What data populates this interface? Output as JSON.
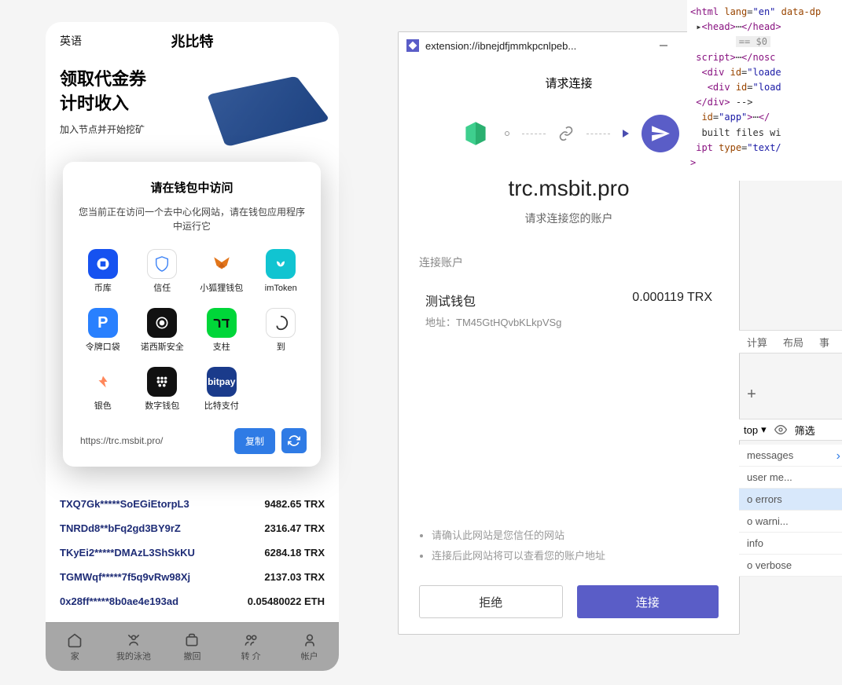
{
  "mobile": {
    "lang": "英语",
    "title": "兆比特",
    "hero_line1": "领取代金券",
    "hero_line2": "计时收入",
    "hero_sub": "加入节点并开始挖矿",
    "transactions": [
      {
        "addr": "TXQ7Gk*****SoEGiEtorpL3",
        "amt": "9482.65 TRX"
      },
      {
        "addr": "TNRDd8**bFq2gd3BY9rZ",
        "amt": "2316.47 TRX"
      },
      {
        "addr": "TKyEi2*****DMAzL3ShSkKU",
        "amt": "6284.18 TRX"
      },
      {
        "addr": "TGMWqf*****7f5q9vRw98Xj",
        "amt": "2137.03 TRX"
      },
      {
        "addr": "0x28ff*****8b0ae4e193ad",
        "amt": "0.05480022 ETH"
      }
    ],
    "nav": [
      "家",
      "我的泳池",
      "撤回",
      "转 介",
      "帐户"
    ]
  },
  "modal": {
    "title": "请在钱包中访问",
    "sub": "您当前正在访问一个去中心化网站，请在钱包应用程序中运行它",
    "wallets": [
      {
        "name": "币库",
        "color": "#1652f0",
        "kind": "coinbase"
      },
      {
        "name": "信任",
        "color": "#ffffff",
        "kind": "trust"
      },
      {
        "name": "小狐狸钱包",
        "color": "#f6851b",
        "kind": "metamask"
      },
      {
        "name": "imToken",
        "color": "#11c4d1",
        "kind": "imtoken"
      },
      {
        "name": "令牌口袋",
        "color": "#2980fe",
        "kind": "tokenpocket"
      },
      {
        "name": "诺西斯安全",
        "color": "#111",
        "kind": "gnosis"
      },
      {
        "name": "支柱",
        "color": "#00d639",
        "kind": "pillar"
      },
      {
        "name": "到",
        "color": "#fff",
        "kind": "onto"
      },
      {
        "name": "银色",
        "color": "#fff",
        "kind": "argent"
      },
      {
        "name": "数字钱包",
        "color": "#111",
        "kind": "math"
      },
      {
        "name": "比特支付",
        "color": "#1a3b8b",
        "kind": "bitpay"
      }
    ],
    "url": "https://trc.msbit.pro/",
    "copy_label": "复制"
  },
  "ext": {
    "title": "extension://ibnejdfjmmkpcnlpeb...",
    "header": "请求连接",
    "domain": "trc.msbit.pro",
    "sub": "请求连接您的账户",
    "section": "连接账户",
    "account_name": "测试钱包",
    "account_balance": "0.000119 TRX",
    "account_addr": "地址：TM45GtHQvbKLkpVSg",
    "notices": [
      "请确认此网站是您信任的网站",
      "连接后此网站将可以查看您的账户地址"
    ],
    "reject": "拒绝",
    "connect": "连接"
  },
  "devtools": {
    "tabs": [
      "计算",
      "布局",
      "事"
    ],
    "filter_top": "top",
    "filter_right": "筛选",
    "console_filters": [
      {
        "label": "messages"
      },
      {
        "label": "user me..."
      },
      {
        "label": "o errors"
      },
      {
        "label": "o warni..."
      },
      {
        "label": "info"
      },
      {
        "label": "o verbose"
      }
    ]
  }
}
